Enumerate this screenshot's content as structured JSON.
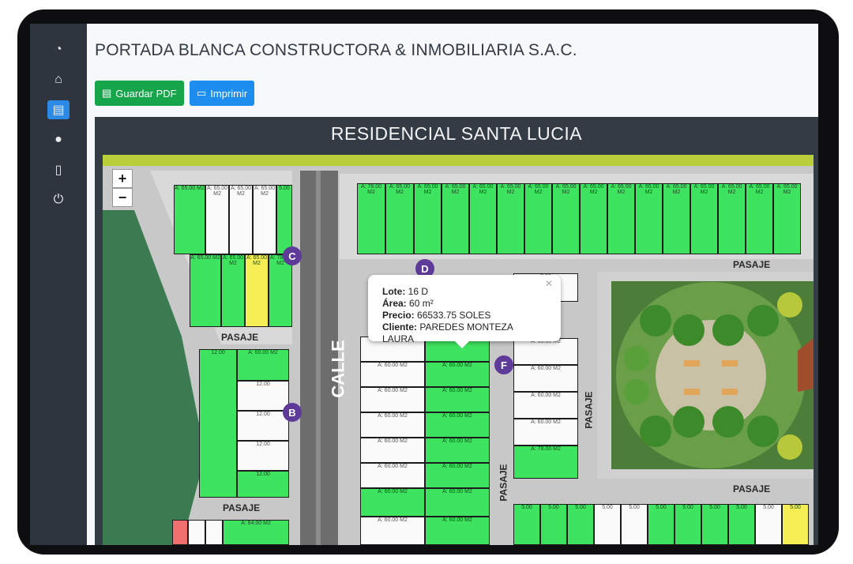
{
  "sidebar": {
    "items": [
      {
        "icon": "pie-chart-icon",
        "glyph": "◔",
        "active": false
      },
      {
        "icon": "home-icon",
        "glyph": "⌂",
        "active": false
      },
      {
        "icon": "map-icon",
        "glyph": "▤",
        "active": true
      },
      {
        "icon": "user-icon",
        "glyph": "●",
        "active": false
      },
      {
        "icon": "document-icon",
        "glyph": "▯",
        "active": false
      },
      {
        "icon": "power-icon",
        "glyph": "⏻",
        "active": false
      }
    ]
  },
  "header": {
    "company": "PORTADA BLANCA CONSTRUCTORA & INMOBILIARIA S.A.C."
  },
  "toolbar": {
    "pdf_label": "Guardar PDF",
    "print_label": "Imprimir"
  },
  "plan": {
    "title": "RESIDENCIAL SANTA LUCIA",
    "street_label": "CALLE",
    "pasaje_label": "PASAJE",
    "zoom_in": "+",
    "zoom_out": "−",
    "markers": [
      "C",
      "D",
      "B",
      "F"
    ]
  },
  "popup": {
    "lote_label": "Lote:",
    "lote": "16 D",
    "area_label": "Área:",
    "area": "60 m²",
    "precio_label": "Precio:",
    "precio": "66533.75 SOLES",
    "cliente_label": "Cliente:",
    "cliente": "PAREDES MONTEZA LAURA"
  },
  "lot_text": {
    "a65": "A: 65.00 M2",
    "a60": "A: 60.00 M2",
    "a78": "A: 78.00 M2",
    "a84": "A: 84.00 M2",
    "w5": "5.00",
    "w12": "12.00"
  },
  "colors": {
    "sold": "#3ee45f",
    "available": "#fafafa",
    "reserved": "#f5ef55",
    "blocked": "#f06f6f",
    "accent": "#2b8ae6"
  }
}
